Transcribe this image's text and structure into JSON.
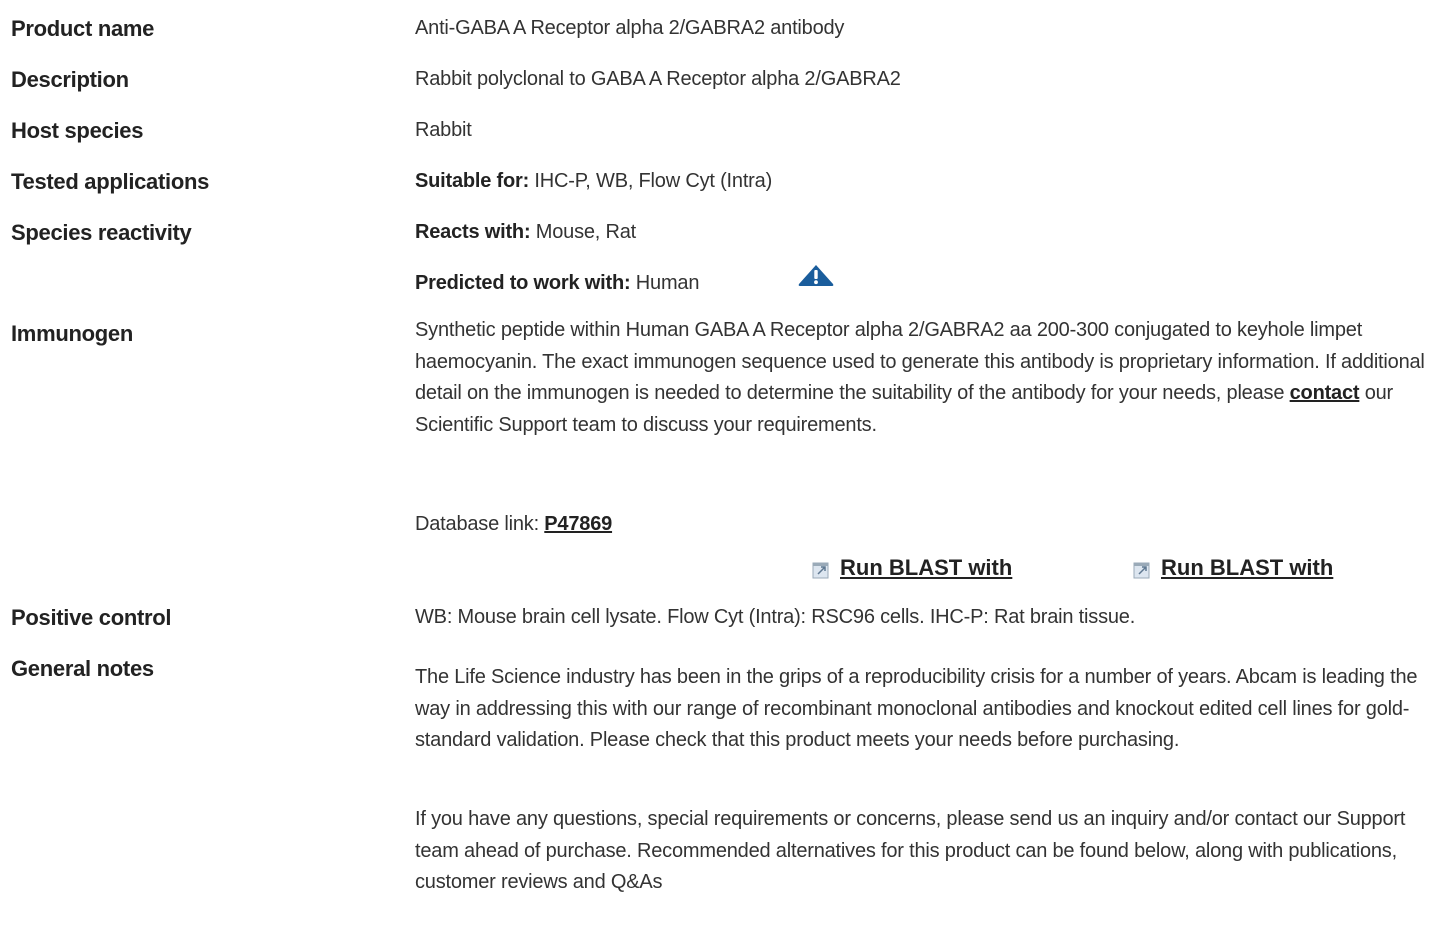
{
  "rows": {
    "product_name": {
      "label": "Product name",
      "value": "Anti-GABA A Receptor alpha 2/GABRA2 antibody"
    },
    "description": {
      "label": "Description",
      "value": "Rabbit polyclonal to GABA A Receptor alpha 2/GABRA2"
    },
    "host_species": {
      "label": "Host species",
      "value": "Rabbit"
    },
    "tested_applications": {
      "label": "Tested applications",
      "prefix": "Suitable for:",
      "value": " IHC-P, WB, Flow Cyt (Intra)"
    },
    "species_reactivity": {
      "label": "Species reactivity",
      "reacts_prefix": "Reacts with:",
      "reacts_value": " Mouse, Rat",
      "predicted_prefix": "Predicted to work with:",
      "predicted_value": " Human"
    },
    "immunogen": {
      "label": "Immunogen",
      "text_before_link": "Synthetic peptide within Human GABA A Receptor alpha 2/GABRA2 aa 200-300 conjugated to keyhole limpet haemocyanin. The exact immunogen sequence used to generate this antibody is proprietary information. If additional detail on the immunogen is needed to determine the suitability of the antibody for your needs, please ",
      "link_text": "contact",
      "text_after_link": " our Scientific Support team to discuss your requirements.",
      "db_prefix": "Database link: ",
      "db_link": "P47869",
      "blast_1": "Run BLAST with",
      "blast_2": "Run BLAST with"
    },
    "positive_control": {
      "label": "Positive control",
      "value": "WB: Mouse brain cell lysate. Flow Cyt (Intra): RSC96 cells. IHC-P: Rat brain tissue."
    },
    "general_notes": {
      "label": "General notes",
      "para_1": "The Life Science industry has been in the grips of a reproducibility crisis for a number of years. Abcam is leading the way in addressing this with our range of recombinant monoclonal antibodies and knockout edited cell lines for gold-standard validation. Please check that this product meets your needs before purchasing.",
      "para_2": "If you have any questions, special requirements or concerns, please send us an inquiry and/or contact our Support team ahead of purchase. Recommended alternatives for this product can be found below, along with publications, customer reviews and Q&As"
    }
  },
  "icons": {
    "warning": "warning-triangle-icon",
    "external_link": "external-link-icon"
  },
  "colors": {
    "warning_icon": "#1a5d9c",
    "text": "#333333",
    "label": "#222222"
  }
}
